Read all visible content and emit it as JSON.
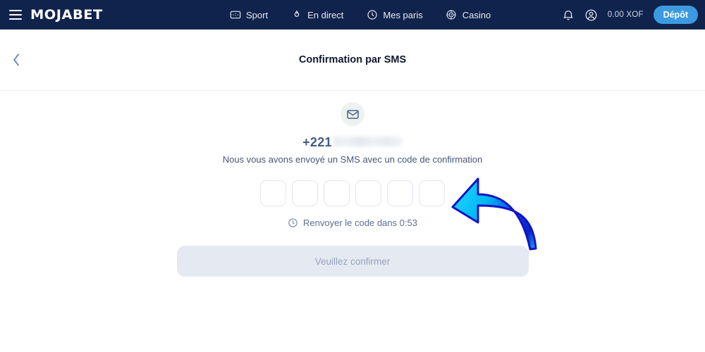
{
  "header": {
    "menu_icon": "hamburger-menu-icon",
    "logo": "MOJABET",
    "nav": [
      {
        "label": "Sport",
        "icon": "scoreboard-icon"
      },
      {
        "label": "En direct",
        "icon": "flame-icon"
      },
      {
        "label": "Mes paris",
        "icon": "clock-icon"
      },
      {
        "label": "Casino",
        "icon": "casino-chip-icon"
      }
    ],
    "notifications_icon": "bell-icon",
    "account_icon": "user-account-icon",
    "balance": "0.00 XOF",
    "deposit_label": "Dépôt",
    "bg_color": "#10234c",
    "deposit_color": "#3c9ae0"
  },
  "titlebar": {
    "back_icon": "chevron-left-icon",
    "title": "Confirmation par SMS"
  },
  "main": {
    "mail_icon": "envelope-icon",
    "phone_prefix": "+221",
    "phone_masked": true,
    "subtitle": "Nous vous avons envoyé un SMS avec un code de confirmation",
    "otp": {
      "count": 6,
      "values": [
        "",
        "",
        "",
        "",
        "",
        ""
      ],
      "placeholder": ""
    },
    "resend": {
      "icon": "clock-icon",
      "label": "Renvoyer le code dans 0:53"
    },
    "confirm_label": "Veuillez confirmer"
  },
  "annotation": {
    "arrow_icon": "curved-arrow-left-icon",
    "color_light": "#00d2ff",
    "color_dark": "#0a12d8"
  }
}
